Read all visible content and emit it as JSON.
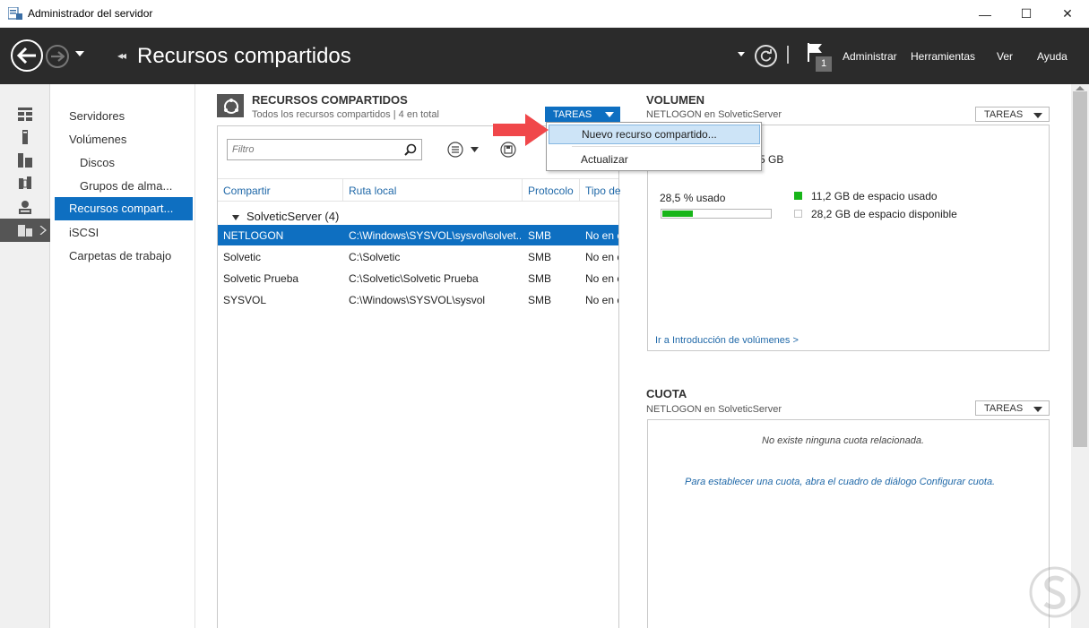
{
  "window": {
    "title": "Administrador del servidor",
    "controls": {
      "minimize": "—",
      "maximize": "☐",
      "close": "✕"
    }
  },
  "header": {
    "breadcrumb_prefix": "◂◂",
    "page_title": "Recursos compartidos",
    "notification_count": "1",
    "menu": [
      "Administrar",
      "Herramientas",
      "Ver",
      "Ayuda"
    ]
  },
  "rail": {
    "items": [
      "dashboard-icon",
      "local-server-icon",
      "all-servers-icon",
      "role-group-icon",
      "file-storage-icon",
      "shares-icon"
    ]
  },
  "subnav": {
    "items": [
      {
        "label": "Servidores",
        "indent": false,
        "active": false
      },
      {
        "label": "Volúmenes",
        "indent": false,
        "active": false
      },
      {
        "label": "Discos",
        "indent": true,
        "active": false
      },
      {
        "label": "Grupos de alma...",
        "indent": true,
        "active": false
      },
      {
        "label": "Recursos compart...",
        "indent": false,
        "active": true
      },
      {
        "label": "iSCSI",
        "indent": false,
        "active": false
      },
      {
        "label": "Carpetas de trabajo",
        "indent": false,
        "active": false
      }
    ]
  },
  "shares": {
    "title": "RECURSOS COMPARTIDOS",
    "subtitle": "Todos los recursos compartidos | 4 en total",
    "tasks_label": "TAREAS",
    "filter_placeholder": "Filtro",
    "columns": [
      "Compartir",
      "Ruta local",
      "Protocolo",
      "Tipo de"
    ],
    "group": "SolveticServer (4)",
    "rows": [
      {
        "share": "NETLOGON",
        "path": "C:\\Windows\\SYSVOL\\sysvol\\solvet...",
        "protocol": "SMB",
        "type": "No en c",
        "selected": true
      },
      {
        "share": "Solvetic",
        "path": "C:\\Solvetic",
        "protocol": "SMB",
        "type": "No en c",
        "selected": false
      },
      {
        "share": "Solvetic Prueba",
        "path": "C:\\Solvetic\\Solvetic Prueba",
        "protocol": "SMB",
        "type": "No en c",
        "selected": false
      },
      {
        "share": "SYSVOL",
        "path": "C:\\Windows\\SYSVOL\\sysvol",
        "protocol": "SMB",
        "type": "No en c",
        "selected": false
      }
    ]
  },
  "tasks_menu": {
    "items": [
      "Nuevo recurso compartido...",
      "Actualizar"
    ],
    "highlighted": "Nuevo recurso compartido..."
  },
  "volume": {
    "title": "VOLUMEN",
    "subtitle": "NETLOGON en SolveticServer",
    "tasks_label": "TAREAS",
    "capacity_partial": "5 GB",
    "used_label": "28,5 % usado",
    "used_fraction": 0.285,
    "used_space": "11,2 GB de espacio usado",
    "free_space": "28,2 GB de espacio disponible",
    "used_color": "#18b519",
    "link": "Ir a Introducción de volúmenes >"
  },
  "quota": {
    "title": "CUOTA",
    "subtitle": "NETLOGON en SolveticServer",
    "tasks_label": "TAREAS",
    "empty_message": "No existe ninguna cuota relacionada.",
    "hint": "Para establecer una cuota, abra el cuadro de diálogo Configurar cuota."
  },
  "colors": {
    "accent": "#0e6fc1",
    "header_bg": "#2b2b2b",
    "annotation_arrow": "#f0474a"
  }
}
